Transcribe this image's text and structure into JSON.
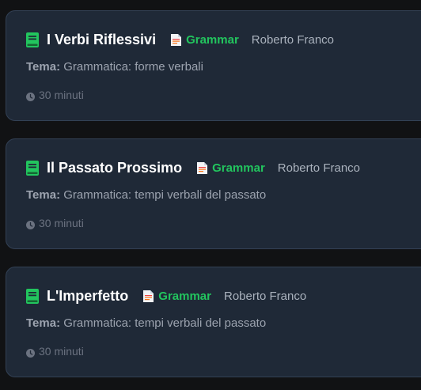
{
  "lessons": [
    {
      "title": "I Verbi Riflessivi",
      "tag": "Grammar",
      "author": "Roberto Franco",
      "tema_label": "Tema:",
      "tema_value": "Grammatica: forme verbali",
      "duration": "30 minuti"
    },
    {
      "title": "Il Passato Prossimo",
      "tag": "Grammar",
      "author": "Roberto Franco",
      "tema_label": "Tema:",
      "tema_value": "Grammatica: tempi verbali del passato",
      "duration": "30 minuti"
    },
    {
      "title": "L'Imperfetto",
      "tag": "Grammar",
      "author": "Roberto Franco",
      "tema_label": "Tema:",
      "tema_value": "Grammatica: tempi verbali del passato",
      "duration": "30 minuti"
    }
  ],
  "colors": {
    "background": "#111214",
    "card": "#1f2937",
    "accent_green": "#22c55e",
    "title": "#ffffff",
    "muted": "#9ca3af"
  },
  "icons": [
    "book-icon",
    "document-icon",
    "clock-icon"
  ]
}
